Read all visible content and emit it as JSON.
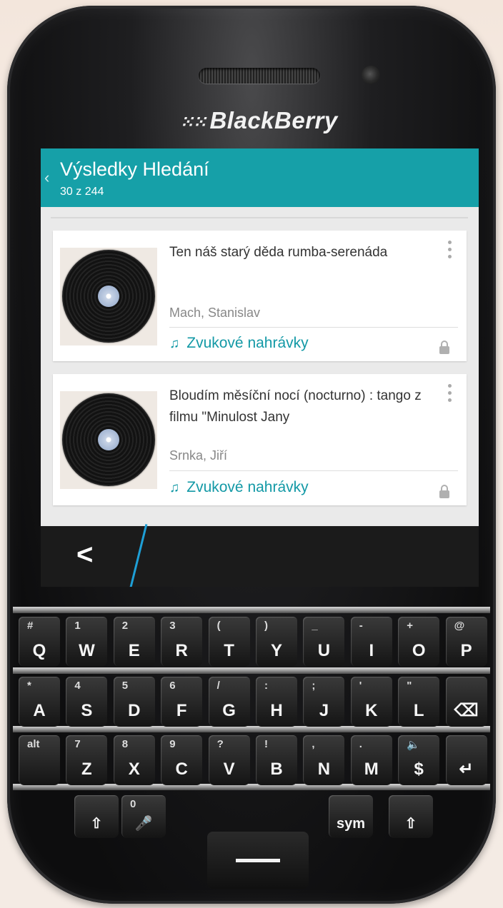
{
  "device": {
    "brand": "BlackBerry",
    "brand_icon": "blackberry-logo-icon"
  },
  "header": {
    "title": "Výsledky Hledání",
    "subtitle": "30 z 244"
  },
  "results": [
    {
      "title": "Ten náš starý děda rumba-serenáda",
      "author": "Mach, Stanislav",
      "type": "Zvukové nahrávky",
      "type_icon": "music-note-icon",
      "thumb_icon": "vinyl-record-icon"
    },
    {
      "title": "Bloudím měsíční nocí (nocturno) : tango z filmu \"Minulost Jany",
      "author": "Srnka, Jiří",
      "type": "Zvukové nahrávky",
      "type_icon": "music-note-icon",
      "thumb_icon": "vinyl-record-icon"
    }
  ],
  "actionbar": {
    "back_glyph": "<"
  },
  "keyboard": {
    "row1": [
      {
        "main": "Q",
        "alt": "#"
      },
      {
        "main": "W",
        "alt": "1"
      },
      {
        "main": "E",
        "alt": "2"
      },
      {
        "main": "R",
        "alt": "3"
      },
      {
        "main": "T",
        "alt": "("
      },
      {
        "main": "Y",
        "alt": ")"
      },
      {
        "main": "U",
        "alt": "_"
      },
      {
        "main": "I",
        "alt": "-"
      },
      {
        "main": "O",
        "alt": "+"
      },
      {
        "main": "P",
        "alt": "@"
      }
    ],
    "row2": [
      {
        "main": "A",
        "alt": "*"
      },
      {
        "main": "S",
        "alt": "4"
      },
      {
        "main": "D",
        "alt": "5"
      },
      {
        "main": "F",
        "alt": "6"
      },
      {
        "main": "G",
        "alt": "/"
      },
      {
        "main": "H",
        "alt": ":"
      },
      {
        "main": "J",
        "alt": ";"
      },
      {
        "main": "K",
        "alt": "'"
      },
      {
        "main": "L",
        "alt": "\""
      },
      {
        "main": "⌫",
        "alt": ""
      }
    ],
    "row3": [
      {
        "main": "",
        "alt": "alt"
      },
      {
        "main": "Z",
        "alt": "7"
      },
      {
        "main": "X",
        "alt": "8"
      },
      {
        "main": "C",
        "alt": "9"
      },
      {
        "main": "V",
        "alt": "?"
      },
      {
        "main": "B",
        "alt": "!"
      },
      {
        "main": "N",
        "alt": ","
      },
      {
        "main": "M",
        "alt": "."
      },
      {
        "main": "$",
        "alt": "🔈"
      },
      {
        "main": "↵",
        "alt": ""
      }
    ],
    "bottom": [
      {
        "main": "⇧",
        "alt": ""
      },
      {
        "main": "🎤",
        "alt": "0"
      },
      {
        "main": "sym",
        "alt": ""
      },
      {
        "main": "⇧",
        "alt": ""
      }
    ]
  }
}
